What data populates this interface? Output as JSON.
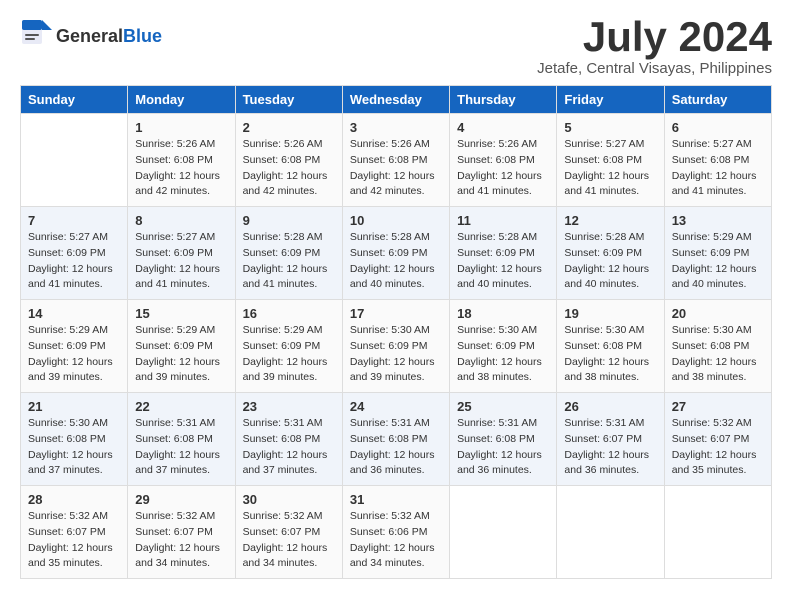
{
  "header": {
    "logo_general": "General",
    "logo_blue": "Blue",
    "month_title": "July 2024",
    "location": "Jetafe, Central Visayas, Philippines"
  },
  "calendar": {
    "days_of_week": [
      "Sunday",
      "Monday",
      "Tuesday",
      "Wednesday",
      "Thursday",
      "Friday",
      "Saturday"
    ],
    "weeks": [
      [
        {
          "day": "",
          "info": ""
        },
        {
          "day": "1",
          "info": "Sunrise: 5:26 AM\nSunset: 6:08 PM\nDaylight: 12 hours\nand 42 minutes."
        },
        {
          "day": "2",
          "info": "Sunrise: 5:26 AM\nSunset: 6:08 PM\nDaylight: 12 hours\nand 42 minutes."
        },
        {
          "day": "3",
          "info": "Sunrise: 5:26 AM\nSunset: 6:08 PM\nDaylight: 12 hours\nand 42 minutes."
        },
        {
          "day": "4",
          "info": "Sunrise: 5:26 AM\nSunset: 6:08 PM\nDaylight: 12 hours\nand 41 minutes."
        },
        {
          "day": "5",
          "info": "Sunrise: 5:27 AM\nSunset: 6:08 PM\nDaylight: 12 hours\nand 41 minutes."
        },
        {
          "day": "6",
          "info": "Sunrise: 5:27 AM\nSunset: 6:08 PM\nDaylight: 12 hours\nand 41 minutes."
        }
      ],
      [
        {
          "day": "7",
          "info": "Sunrise: 5:27 AM\nSunset: 6:09 PM\nDaylight: 12 hours\nand 41 minutes."
        },
        {
          "day": "8",
          "info": "Sunrise: 5:27 AM\nSunset: 6:09 PM\nDaylight: 12 hours\nand 41 minutes."
        },
        {
          "day": "9",
          "info": "Sunrise: 5:28 AM\nSunset: 6:09 PM\nDaylight: 12 hours\nand 41 minutes."
        },
        {
          "day": "10",
          "info": "Sunrise: 5:28 AM\nSunset: 6:09 PM\nDaylight: 12 hours\nand 40 minutes."
        },
        {
          "day": "11",
          "info": "Sunrise: 5:28 AM\nSunset: 6:09 PM\nDaylight: 12 hours\nand 40 minutes."
        },
        {
          "day": "12",
          "info": "Sunrise: 5:28 AM\nSunset: 6:09 PM\nDaylight: 12 hours\nand 40 minutes."
        },
        {
          "day": "13",
          "info": "Sunrise: 5:29 AM\nSunset: 6:09 PM\nDaylight: 12 hours\nand 40 minutes."
        }
      ],
      [
        {
          "day": "14",
          "info": "Sunrise: 5:29 AM\nSunset: 6:09 PM\nDaylight: 12 hours\nand 39 minutes."
        },
        {
          "day": "15",
          "info": "Sunrise: 5:29 AM\nSunset: 6:09 PM\nDaylight: 12 hours\nand 39 minutes."
        },
        {
          "day": "16",
          "info": "Sunrise: 5:29 AM\nSunset: 6:09 PM\nDaylight: 12 hours\nand 39 minutes."
        },
        {
          "day": "17",
          "info": "Sunrise: 5:30 AM\nSunset: 6:09 PM\nDaylight: 12 hours\nand 39 minutes."
        },
        {
          "day": "18",
          "info": "Sunrise: 5:30 AM\nSunset: 6:09 PM\nDaylight: 12 hours\nand 38 minutes."
        },
        {
          "day": "19",
          "info": "Sunrise: 5:30 AM\nSunset: 6:08 PM\nDaylight: 12 hours\nand 38 minutes."
        },
        {
          "day": "20",
          "info": "Sunrise: 5:30 AM\nSunset: 6:08 PM\nDaylight: 12 hours\nand 38 minutes."
        }
      ],
      [
        {
          "day": "21",
          "info": "Sunrise: 5:30 AM\nSunset: 6:08 PM\nDaylight: 12 hours\nand 37 minutes."
        },
        {
          "day": "22",
          "info": "Sunrise: 5:31 AM\nSunset: 6:08 PM\nDaylight: 12 hours\nand 37 minutes."
        },
        {
          "day": "23",
          "info": "Sunrise: 5:31 AM\nSunset: 6:08 PM\nDaylight: 12 hours\nand 37 minutes."
        },
        {
          "day": "24",
          "info": "Sunrise: 5:31 AM\nSunset: 6:08 PM\nDaylight: 12 hours\nand 36 minutes."
        },
        {
          "day": "25",
          "info": "Sunrise: 5:31 AM\nSunset: 6:08 PM\nDaylight: 12 hours\nand 36 minutes."
        },
        {
          "day": "26",
          "info": "Sunrise: 5:31 AM\nSunset: 6:07 PM\nDaylight: 12 hours\nand 36 minutes."
        },
        {
          "day": "27",
          "info": "Sunrise: 5:32 AM\nSunset: 6:07 PM\nDaylight: 12 hours\nand 35 minutes."
        }
      ],
      [
        {
          "day": "28",
          "info": "Sunrise: 5:32 AM\nSunset: 6:07 PM\nDaylight: 12 hours\nand 35 minutes."
        },
        {
          "day": "29",
          "info": "Sunrise: 5:32 AM\nSunset: 6:07 PM\nDaylight: 12 hours\nand 34 minutes."
        },
        {
          "day": "30",
          "info": "Sunrise: 5:32 AM\nSunset: 6:07 PM\nDaylight: 12 hours\nand 34 minutes."
        },
        {
          "day": "31",
          "info": "Sunrise: 5:32 AM\nSunset: 6:06 PM\nDaylight: 12 hours\nand 34 minutes."
        },
        {
          "day": "",
          "info": ""
        },
        {
          "day": "",
          "info": ""
        },
        {
          "day": "",
          "info": ""
        }
      ]
    ]
  }
}
